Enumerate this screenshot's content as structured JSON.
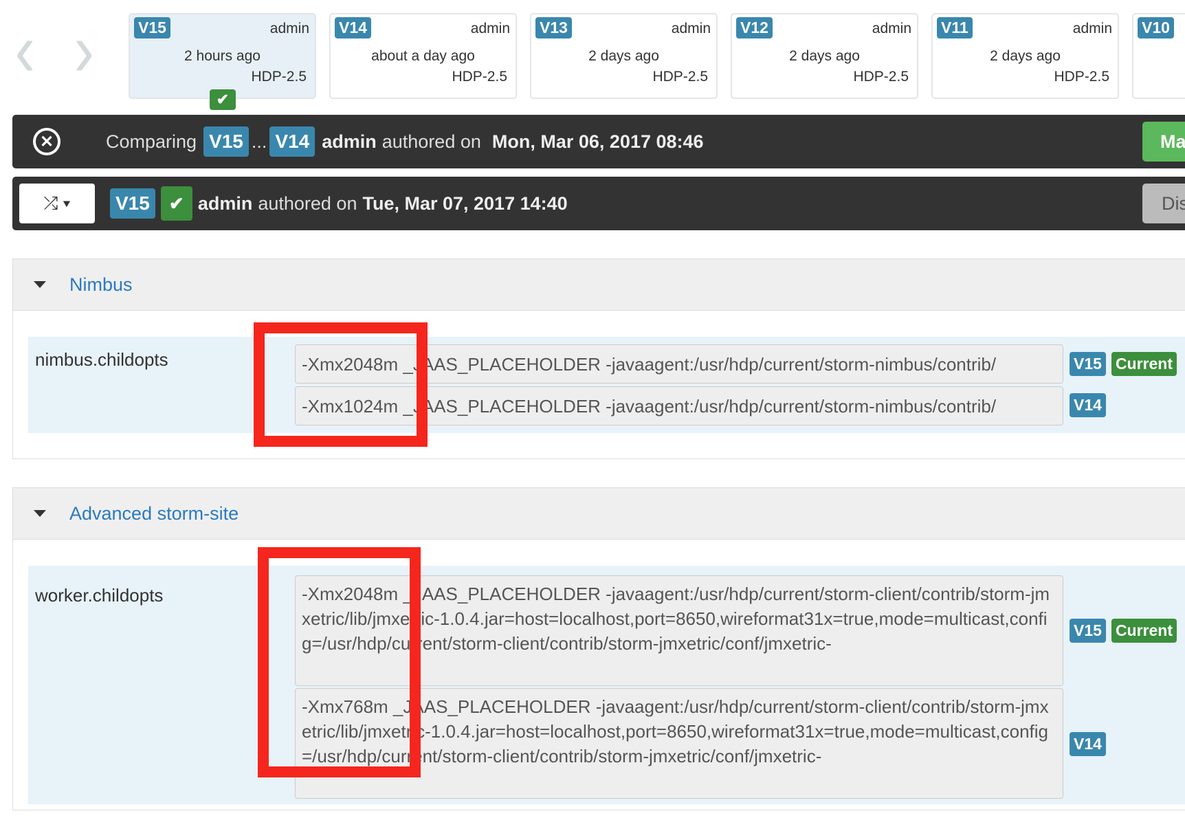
{
  "nav": {
    "prev": "‹",
    "next": "›"
  },
  "versions": [
    {
      "label": "V15",
      "user": "admin",
      "time": "2 hours ago",
      "stack": "HDP-2.5",
      "selected": true
    },
    {
      "label": "V14",
      "user": "admin",
      "time": "about a day ago",
      "stack": "HDP-2.5"
    },
    {
      "label": "V13",
      "user": "admin",
      "time": "2 days ago",
      "stack": "HDP-2.5"
    },
    {
      "label": "V12",
      "user": "admin",
      "time": "2 days ago",
      "stack": "HDP-2.5"
    },
    {
      "label": "V11",
      "user": "admin",
      "time": "2 days ago",
      "stack": "HDP-2.5"
    },
    {
      "label": "V10",
      "user": "",
      "time": "",
      "stack": ""
    }
  ],
  "compare_bar": {
    "comparing": "Comparing",
    "v1": "V15",
    "sep": "...",
    "v2": "V14",
    "author": "admin",
    "authored": "authored on",
    "date": "Mon, Mar 06, 2017 08:46",
    "button": "Ma"
  },
  "current_bar": {
    "version": "V15",
    "author": "admin",
    "authored": "authored on",
    "date": "Tue, Mar 07, 2017 14:40",
    "button": "Dis"
  },
  "sections": [
    {
      "title": "Nimbus",
      "property": "nimbus.childopts",
      "values": [
        "-Xmx2048m _JAAS_PLACEHOLDER -javaagent:/usr/hdp/current/storm-nimbus/contrib/",
        "-Xmx1024m _JAAS_PLACEHOLDER -javaagent:/usr/hdp/current/storm-nimbus/contrib/"
      ]
    },
    {
      "title": "Advanced storm-site",
      "property": "worker.childopts",
      "values": [
        "-Xmx2048m _JAAS_PLACEHOLDER -javaagent:/usr/hdp/current/storm-client/contrib/storm-jmxetric/lib/jmxetric-1.0.4.jar=host=localhost,port=8650,wireformat31x=true,mode=multicast,config=/usr/hdp/current/storm-client/contrib/storm-jmxetric/conf/jmxetric-",
        "-Xmx768m _JAAS_PLACEHOLDER -javaagent:/usr/hdp/current/storm-client/contrib/storm-jmxetric/lib/jmxetric-1.0.4.jar=host=localhost,port=8650,wireformat31x=true,mode=multicast,config=/usr/hdp/current/storm-client/contrib/storm-jmxetric/conf/jmxetric-"
      ]
    }
  ],
  "badges": {
    "v15": "V15",
    "v14": "V14",
    "current": "Current"
  },
  "colors": {
    "version_badge": "#3a87ad",
    "current_badge": "#3c8f3c",
    "highlight": "#f5261d",
    "bar": "#333333"
  }
}
